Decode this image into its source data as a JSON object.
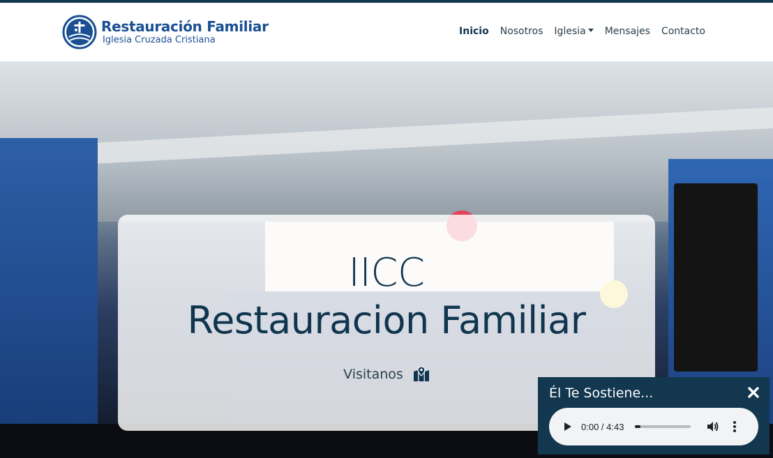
{
  "brand": {
    "title": "Restauración Familiar",
    "subtitle": "Iglesia Cruzada Cristiana",
    "logo_icon": "church-logo-icon",
    "color": "#1a4f93"
  },
  "nav": {
    "items": [
      {
        "label": "Inicio",
        "active": true
      },
      {
        "label": "Nosotros"
      },
      {
        "label": "Iglesia",
        "dropdown": true
      },
      {
        "label": "Mensajes"
      },
      {
        "label": "Contacto"
      }
    ]
  },
  "hero": {
    "title": "IICC",
    "subtitle": "Restauracion Familiar",
    "visit_label": "Visitanos",
    "visit_icon": "map-marked-icon"
  },
  "player": {
    "title": "Él Te Sostiene...",
    "time": "0:00 / 4:43",
    "progress": 0.1,
    "close_icon": "close-icon",
    "play_icon": "play-icon",
    "volume_icon": "volume-icon",
    "more_icon": "more-vert-icon"
  },
  "colors": {
    "primary_dark": "#12374f",
    "text_dark": "#10354e"
  }
}
